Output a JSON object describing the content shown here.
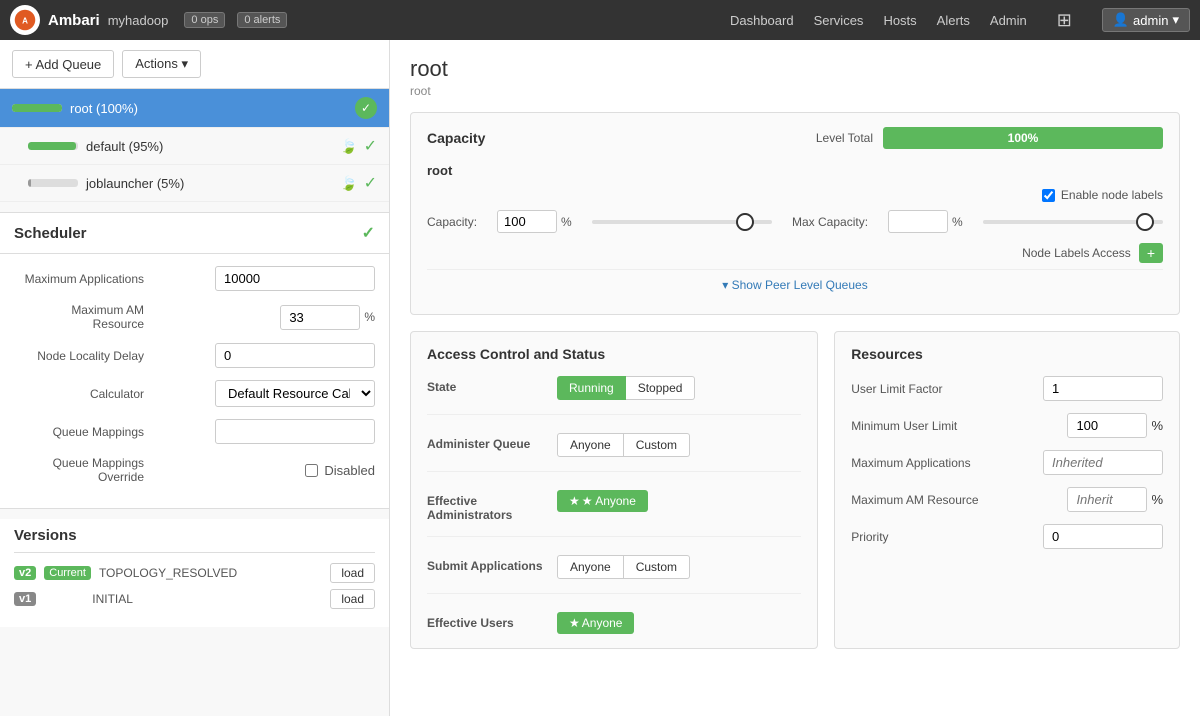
{
  "topnav": {
    "logo_alt": "Ambari",
    "app_name": "Ambari",
    "cluster_name": "myhadoop",
    "ops_badge": "0 ops",
    "alerts_badge": "0 alerts",
    "nav_links": [
      "Dashboard",
      "Services",
      "Hosts",
      "Alerts",
      "Admin"
    ],
    "user_label": "admin"
  },
  "left_panel": {
    "add_queue_label": "+ Add Queue",
    "actions_label": "Actions ▾",
    "queues": [
      {
        "name": "root (100%)",
        "progress": 100,
        "selected": true
      },
      {
        "name": "default (95%)",
        "progress": 95,
        "selected": false
      },
      {
        "name": "joblauncher (5%)",
        "progress": 5,
        "selected": false,
        "gray": true
      }
    ],
    "scheduler_title": "Scheduler",
    "form_fields": [
      {
        "label": "Maximum Applications",
        "value": "10000",
        "type": "text"
      },
      {
        "label": "Maximum AM Resource",
        "value": "33",
        "unit": "%"
      },
      {
        "label": "Node Locality Delay",
        "value": "0"
      },
      {
        "label": "Calculator",
        "value": "Default Resource Cal",
        "type": "select"
      },
      {
        "label": "Queue Mappings",
        "value": "",
        "type": "text"
      },
      {
        "label": "Queue Mappings Override",
        "value": "Disabled",
        "type": "checkbox"
      }
    ],
    "versions_title": "Versions",
    "versions": [
      {
        "badge": "v2",
        "current": true,
        "name": "TOPOLOGY_RESOLVED"
      },
      {
        "badge": "v1",
        "current": false,
        "name": "INITIAL"
      }
    ]
  },
  "right_panel": {
    "page_title": "root",
    "breadcrumb": "root",
    "capacity": {
      "title": "Capacity",
      "level_total_label": "Level Total",
      "level_total_pct": "100%",
      "root_label": "root",
      "enable_node_labels": "Enable node labels",
      "capacity_label": "Capacity:",
      "capacity_value": "100",
      "capacity_unit": "%",
      "slider_pct": 85,
      "max_capacity_label": "Max Capacity:",
      "max_capacity_value": "",
      "max_capacity_unit": "%",
      "max_slider_pct": 90,
      "node_labels_access": "Node Labels Access",
      "show_peer_queues": "▾ Show Peer Level Queues"
    },
    "access_control": {
      "title": "Access Control and Status",
      "state_label": "State",
      "state_running": "Running",
      "state_stopped": "Stopped",
      "administer_queue_label": "Administer Queue",
      "anyone_label": "Anyone",
      "custom_label": "Custom",
      "effective_administrators_label": "Effective Administrators",
      "anyone_star": "★ Anyone",
      "submit_applications_label": "Submit Applications",
      "effective_users_label": "Effective Users",
      "anyone_star2": "★ Anyone"
    },
    "resources": {
      "title": "Resources",
      "fields": [
        {
          "label": "User Limit Factor",
          "value": "1",
          "unit": ""
        },
        {
          "label": "Minimum User Limit",
          "value": "100",
          "unit": "%"
        },
        {
          "label": "Maximum Applications",
          "value": "Inherited",
          "unit": "",
          "placeholder": true
        },
        {
          "label": "Maximum AM Resource",
          "value": "Inherit",
          "unit": "%",
          "placeholder": true
        },
        {
          "label": "Priority",
          "value": "0",
          "unit": ""
        }
      ]
    }
  }
}
